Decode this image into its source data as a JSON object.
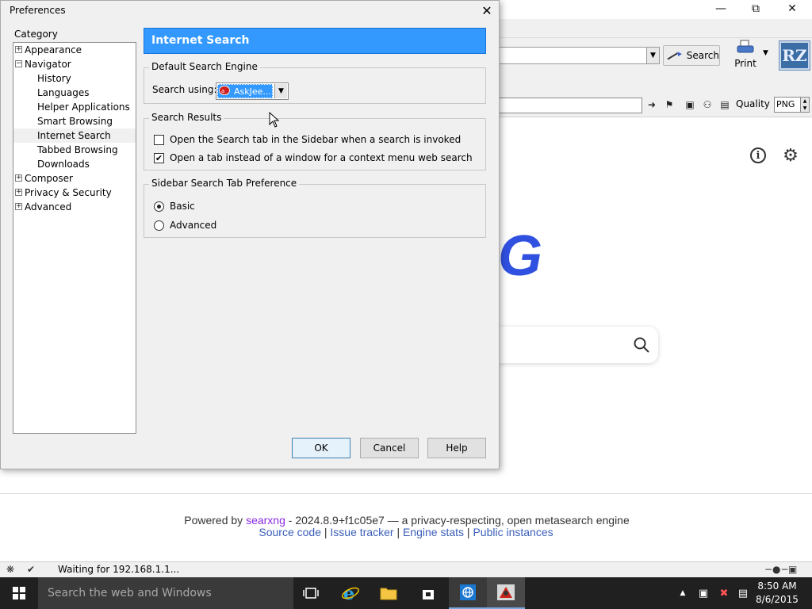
{
  "browser": {
    "search_button_label": "Search",
    "print_label": "Print",
    "logo_text": "RZ",
    "quality_label": "Quality",
    "quality_value": "PNG"
  },
  "page": {
    "logo_letter": "G",
    "footer": {
      "powered_by": "Powered by",
      "brand": "searxng",
      "version_text": "- 2024.8.9+f1c05e7 — a privacy-respecting, open metasearch engine",
      "links": [
        "Source code",
        "Issue tracker",
        "Engine stats",
        "Public instances"
      ],
      "separator": "|"
    }
  },
  "statusbar": {
    "text": "Waiting for 192.168.1.1..."
  },
  "taskbar": {
    "search_placeholder": "Search the web and Windows",
    "time": "8:50 AM",
    "date": "8/6/2015"
  },
  "dialog": {
    "title": "Preferences",
    "category_label": "Category",
    "tree": [
      {
        "label": "Appearance",
        "toggle": "+",
        "child": false,
        "selected": false
      },
      {
        "label": "Navigator",
        "toggle": "−",
        "child": false,
        "selected": false
      },
      {
        "label": "History",
        "child": true,
        "selected": false
      },
      {
        "label": "Languages",
        "child": true,
        "selected": false
      },
      {
        "label": "Helper Applications",
        "child": true,
        "selected": false
      },
      {
        "label": "Smart Browsing",
        "child": true,
        "selected": false
      },
      {
        "label": "Internet Search",
        "child": true,
        "selected": true
      },
      {
        "label": "Tabbed Browsing",
        "child": true,
        "selected": false
      },
      {
        "label": "Downloads",
        "child": true,
        "selected": false
      },
      {
        "label": "Composer",
        "toggle": "+",
        "child": false,
        "selected": false
      },
      {
        "label": "Privacy & Security",
        "toggle": "+",
        "child": false,
        "selected": false
      },
      {
        "label": "Advanced",
        "toggle": "+",
        "child": false,
        "selected": false
      }
    ],
    "panel_title": "Internet Search",
    "default_engine": {
      "legend": "Default Search Engine",
      "search_using_label": "Search using:",
      "selected_engine": "AskJee..."
    },
    "results": {
      "legend": "Search Results",
      "options": [
        {
          "label": "Open the Search tab in the Sidebar when a search is invoked",
          "checked": false
        },
        {
          "label": "Open a tab instead of a window for a context menu web search",
          "checked": true
        }
      ]
    },
    "sidebar_pref": {
      "legend": "Sidebar Search Tab Preference",
      "options": [
        {
          "label": "Basic",
          "selected": true
        },
        {
          "label": "Advanced",
          "selected": false
        }
      ]
    },
    "buttons": {
      "ok": "OK",
      "cancel": "Cancel",
      "help": "Help"
    }
  }
}
